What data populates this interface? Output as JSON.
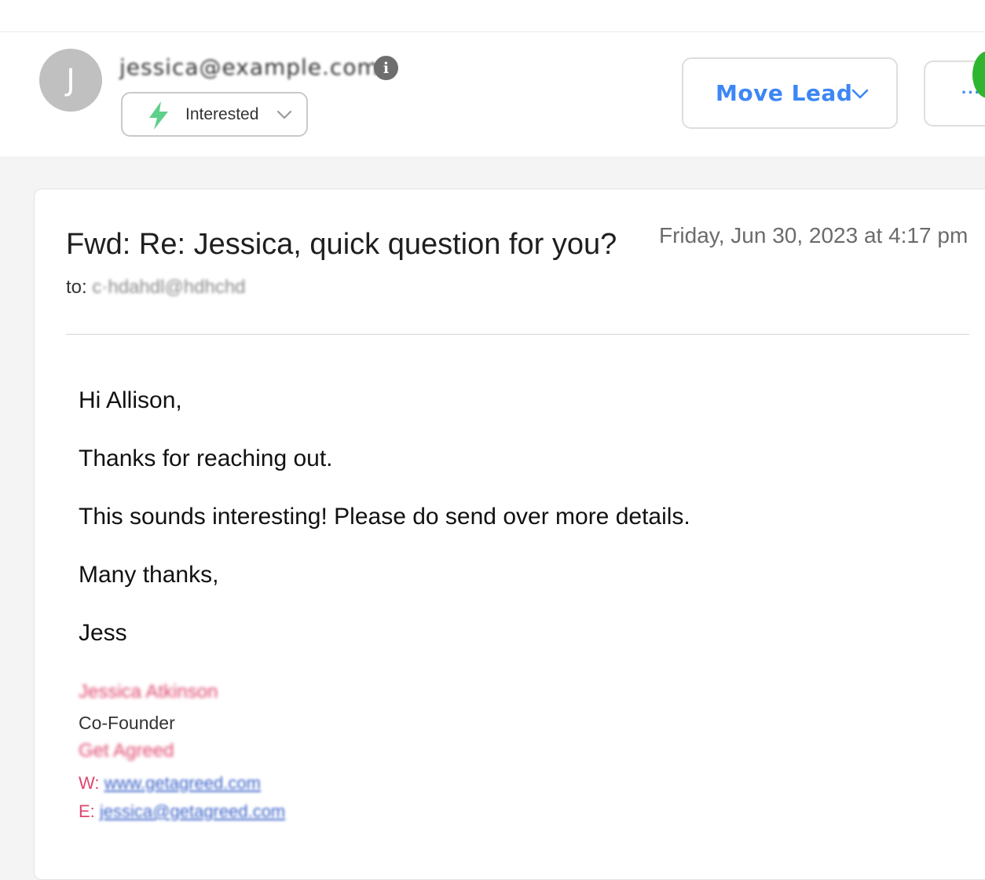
{
  "lead": {
    "avatar_initial": "J",
    "email": "jessica@example.com",
    "status": "Interested"
  },
  "actions": {
    "move_lead_label": "Move Lead",
    "more_label": "···"
  },
  "message": {
    "subject": "Fwd: Re: Jessica, quick question for you?",
    "datetime": "Friday, Jun 30, 2023 at 4:17 pm",
    "to_label": "to:",
    "to_address": "c·hdahdl@hdhchd",
    "body": {
      "greeting": "Hi Allison,",
      "line1": "Thanks for reaching out.",
      "line2": "This sounds interesting! Please do send over more details.",
      "closing": "Many thanks,",
      "name": "Jess"
    },
    "signature": {
      "full_name": "Jessica Atkinson",
      "title": "Co-Founder",
      "company": "Get Agreed",
      "web_label": "W:",
      "web_value": "www.getagreed.com",
      "email_label": "E:",
      "email_value": "jessica@getagreed.com"
    }
  },
  "colors": {
    "accent_blue": "#3d86f5",
    "status_green": "#5fd08a",
    "signature_pink": "#e0456e",
    "link_blue": "#3b63c9"
  },
  "icons": {
    "info": "info-icon",
    "status": "lightning-bolt-icon",
    "dropdown": "chevron-down-icon"
  }
}
